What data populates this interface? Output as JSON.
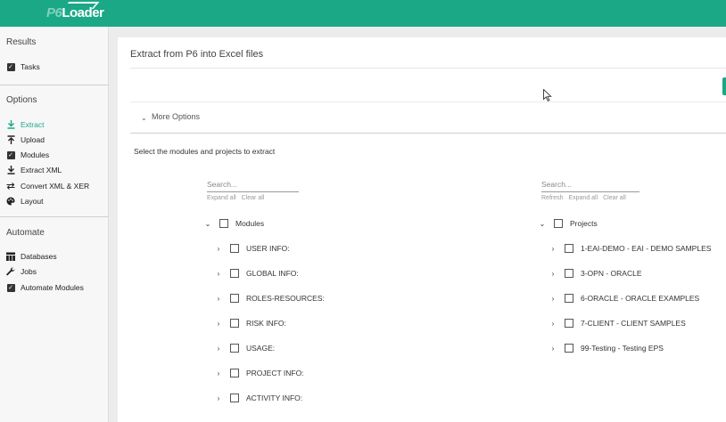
{
  "app": {
    "logo_prefix": "P6",
    "logo_suffix": "Loader"
  },
  "sidebar": {
    "results_heading": "Results",
    "results_items": [
      {
        "label": "Tasks",
        "icon": "checkbox-icon"
      }
    ],
    "options_heading": "Options",
    "options_items": [
      {
        "label": "Extract",
        "icon": "download-icon",
        "active": true
      },
      {
        "label": "Upload",
        "icon": "upload-icon"
      },
      {
        "label": "Modules",
        "icon": "checkbox-icon"
      },
      {
        "label": "Extract XML",
        "icon": "download-icon"
      },
      {
        "label": "Convert XML & XER",
        "icon": "swap-arrows-icon"
      },
      {
        "label": "Layout",
        "icon": "palette-icon"
      }
    ],
    "automate_heading": "Automate",
    "automate_items": [
      {
        "label": "Databases",
        "icon": "table-icon"
      },
      {
        "label": "Jobs",
        "icon": "wrench-icon"
      },
      {
        "label": "Automate Modules",
        "icon": "checkbox-icon"
      }
    ],
    "accent_color": "#1aa886"
  },
  "main": {
    "title": "Extract from P6 into Excel files",
    "more_options": "More Options",
    "select_label": "Select the modules and projects to extract",
    "modules_panel": {
      "search_placeholder": "Search...",
      "expand_all": "Expand all",
      "clear_all": "Clear all",
      "root_label": "Modules",
      "items": [
        "USER INFO:",
        "GLOBAL INFO:",
        "ROLES-RESOURCES:",
        "RISK INFO:",
        "USAGE:",
        "PROJECT INFO:",
        "ACTIVITY INFO:"
      ]
    },
    "projects_panel": {
      "search_placeholder": "Search...",
      "refresh": "Refresh",
      "expand_all": "Expand all",
      "clear_all": "Clear all",
      "root_label": "Projects",
      "items": [
        "1-EAI-DEMO - EAI - DEMO SAMPLES",
        "3-OPN - ORACLE",
        "6-ORACLE - ORACLE EXAMPLES",
        "7-CLIENT - CLIENT SAMPLES",
        "99-Testing - Testing EPS"
      ]
    }
  }
}
